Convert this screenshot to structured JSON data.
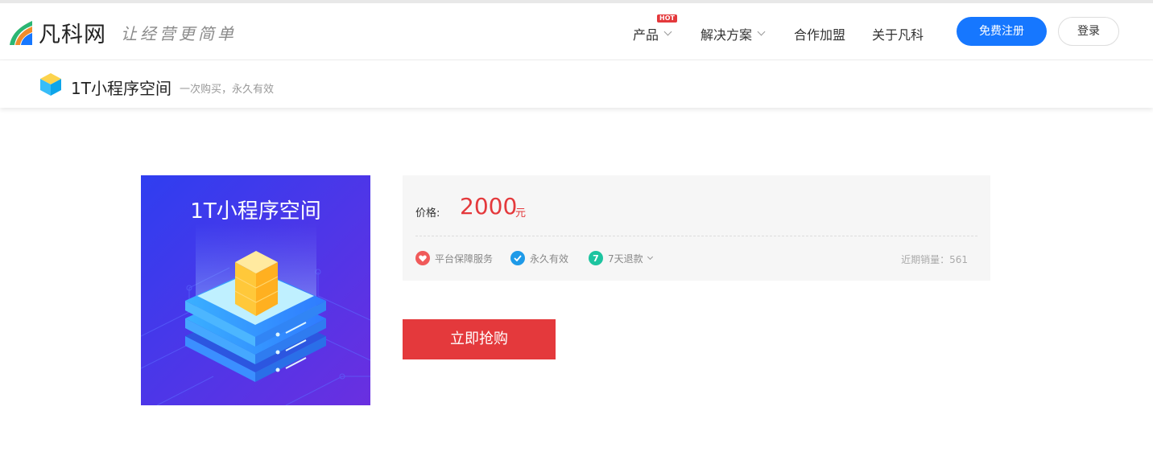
{
  "header": {
    "brand": "凡科网",
    "slogan": "让经营更简单",
    "nav": [
      {
        "label": "产品",
        "badge": "HOT"
      },
      {
        "label": "解决方案"
      },
      {
        "label": "合作加盟"
      },
      {
        "label": "关于凡科"
      }
    ],
    "register_label": "免费注册",
    "login_label": "登录"
  },
  "subheader": {
    "title": "1T小程序空间",
    "desc": "一次购买，永久有效"
  },
  "product": {
    "image_title": "1T小程序空间",
    "price_label": "价格:",
    "price": "2000",
    "unit": "元",
    "services": [
      {
        "label": "平台保障服务",
        "icon": "heart-icon",
        "color": "#f05a5a"
      },
      {
        "label": "永久有效",
        "icon": "check-icon",
        "color": "#1e9ae8"
      },
      {
        "label": "7天退款",
        "icon": "seven-icon",
        "color": "#1dc4a0"
      }
    ],
    "sales_label": "近期销量：",
    "sales_count": "561",
    "buy_label": "立即抢购"
  },
  "colors": {
    "accent": "#1677ff",
    "price": "#e4393c",
    "buy": "#e4393c"
  }
}
